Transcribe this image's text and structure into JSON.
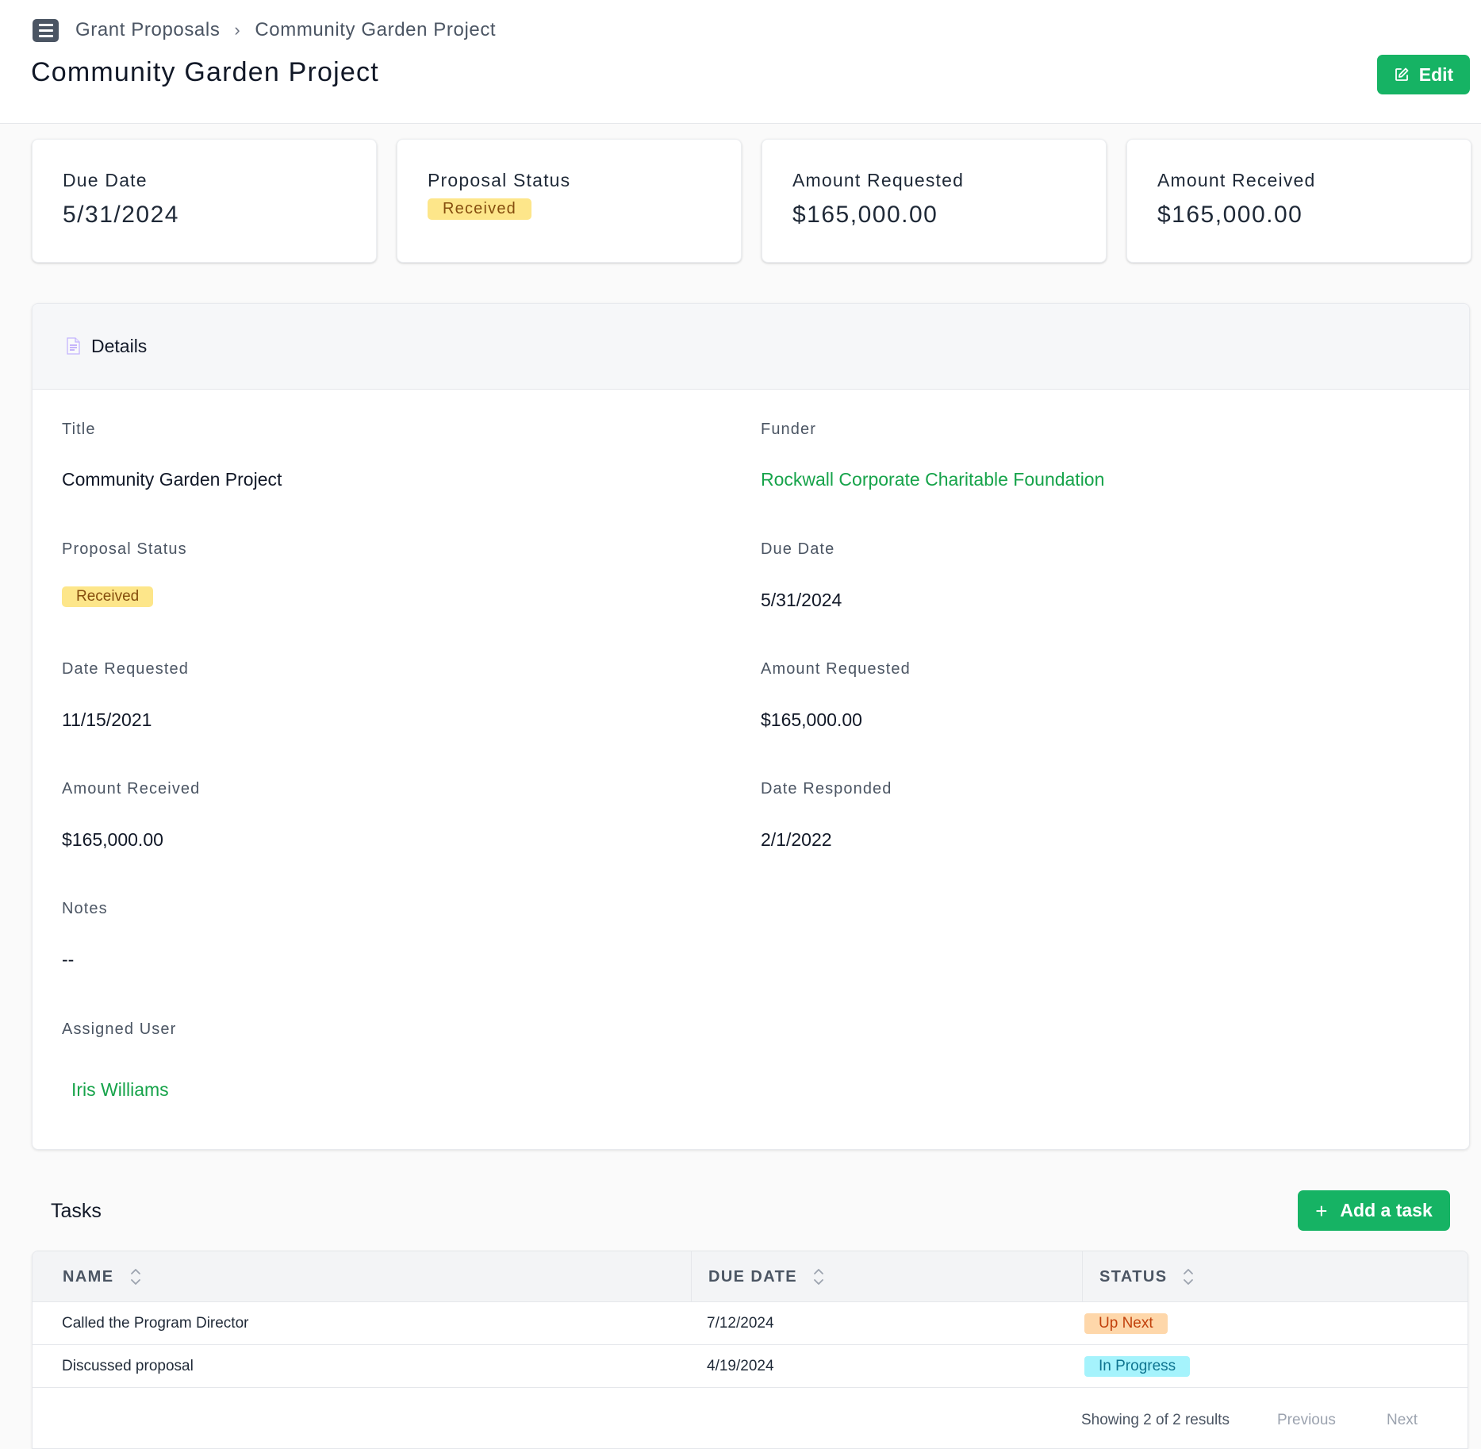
{
  "header": {
    "breadcrumb": [
      "Grant Proposals",
      "Community Garden Project"
    ],
    "title": "Community Garden Project",
    "edit_label": "Edit"
  },
  "stats": [
    {
      "label": "Due Date",
      "value": "5/31/2024"
    },
    {
      "label": "Proposal Status",
      "value": "Received"
    },
    {
      "label": "Amount Requested",
      "value": "$165,000.00"
    },
    {
      "label": "Amount Received",
      "value": "$165,000.00"
    }
  ],
  "details": {
    "heading": "Details",
    "title_label": "Title",
    "title_value": "Community Garden Project",
    "funder_label": "Funder",
    "funder_value": "Rockwall Corporate Charitable Foundation",
    "status_label": "Proposal Status",
    "status_value": "Received",
    "due_label": "Due Date",
    "due_value": "5/31/2024",
    "date_requested_label": "Date Requested",
    "date_requested_value": "11/15/2021",
    "amount_requested_label": "Amount Requested",
    "amount_requested_value": "$165,000.00",
    "amount_received_label": "Amount Received",
    "amount_received_value": "$165,000.00",
    "date_responded_label": "Date Responded",
    "date_responded_value": "2/1/2022",
    "notes_label": "Notes",
    "notes_value": "--",
    "assigned_label": "Assigned User",
    "assigned_value": "Iris Williams"
  },
  "tasks": {
    "heading": "Tasks",
    "add_label": "Add a task",
    "columns": [
      "NAME",
      "DUE DATE",
      "STATUS"
    ],
    "rows": [
      {
        "name": "Called the Program Director",
        "due": "7/12/2024",
        "status": "Up Next"
      },
      {
        "name": "Discussed proposal",
        "due": "4/19/2024",
        "status": "In Progress"
      }
    ],
    "pager_info": "Showing 2 of 2 results",
    "previous": "Previous",
    "next": "Next"
  },
  "colors": {
    "accent": "#16b364",
    "received_badge": "#fde68a",
    "up_next_badge": "#fed7aa",
    "in_progress_badge": "#a5f3fc"
  },
  "icons": [
    "menu-icon",
    "chevron-right-icon",
    "edit-icon",
    "document-icon",
    "plus-icon",
    "sort-icon"
  ]
}
